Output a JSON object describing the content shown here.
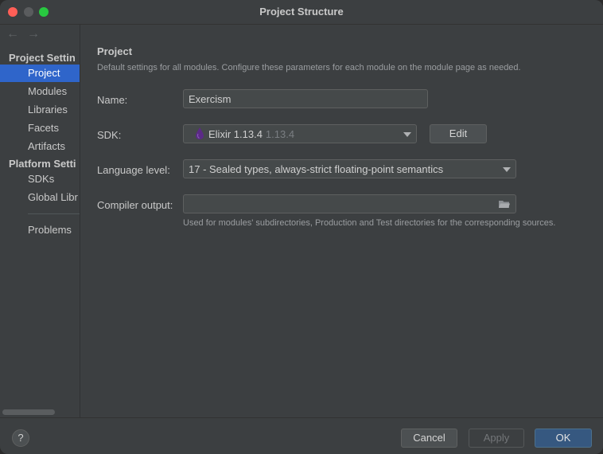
{
  "window": {
    "title": "Project Structure"
  },
  "sidebar": {
    "back_icon": "arrow-left-icon",
    "forward_icon": "arrow-right-icon",
    "project_settings_header": "Project Settin",
    "platform_settings_header": "Platform Setti",
    "items": [
      {
        "label": "Project",
        "selected": true
      },
      {
        "label": "Modules"
      },
      {
        "label": "Libraries"
      },
      {
        "label": "Facets"
      },
      {
        "label": "Artifacts"
      },
      {
        "label": "SDKs"
      },
      {
        "label": "Global Libr"
      },
      {
        "label": "Problems"
      }
    ]
  },
  "main": {
    "heading": "Project",
    "description": "Default settings for all modules. Configure these parameters for each module on the module page as needed.",
    "name": {
      "label": "Name:",
      "value": "Exercism"
    },
    "sdk": {
      "label": "SDK:",
      "name": "Elixir 1.13.4",
      "version": "1.13.4",
      "edit_label": "Edit",
      "icon": "elixir-drop-icon",
      "icon_color": "#5b2a86"
    },
    "language_level": {
      "label": "Language level:",
      "value": "17 - Sealed types, always-strict floating-point semantics"
    },
    "compiler_output": {
      "label": "Compiler output:",
      "value": "",
      "icon": "folder-icon",
      "hint": "Used for modules' subdirectories, Production and Test directories for the corresponding sources."
    }
  },
  "footer": {
    "help_label": "?",
    "cancel_label": "Cancel",
    "apply_label": "Apply",
    "ok_label": "OK"
  },
  "colors": {
    "selection": "#2f65ca",
    "primary_button": "#365880"
  }
}
